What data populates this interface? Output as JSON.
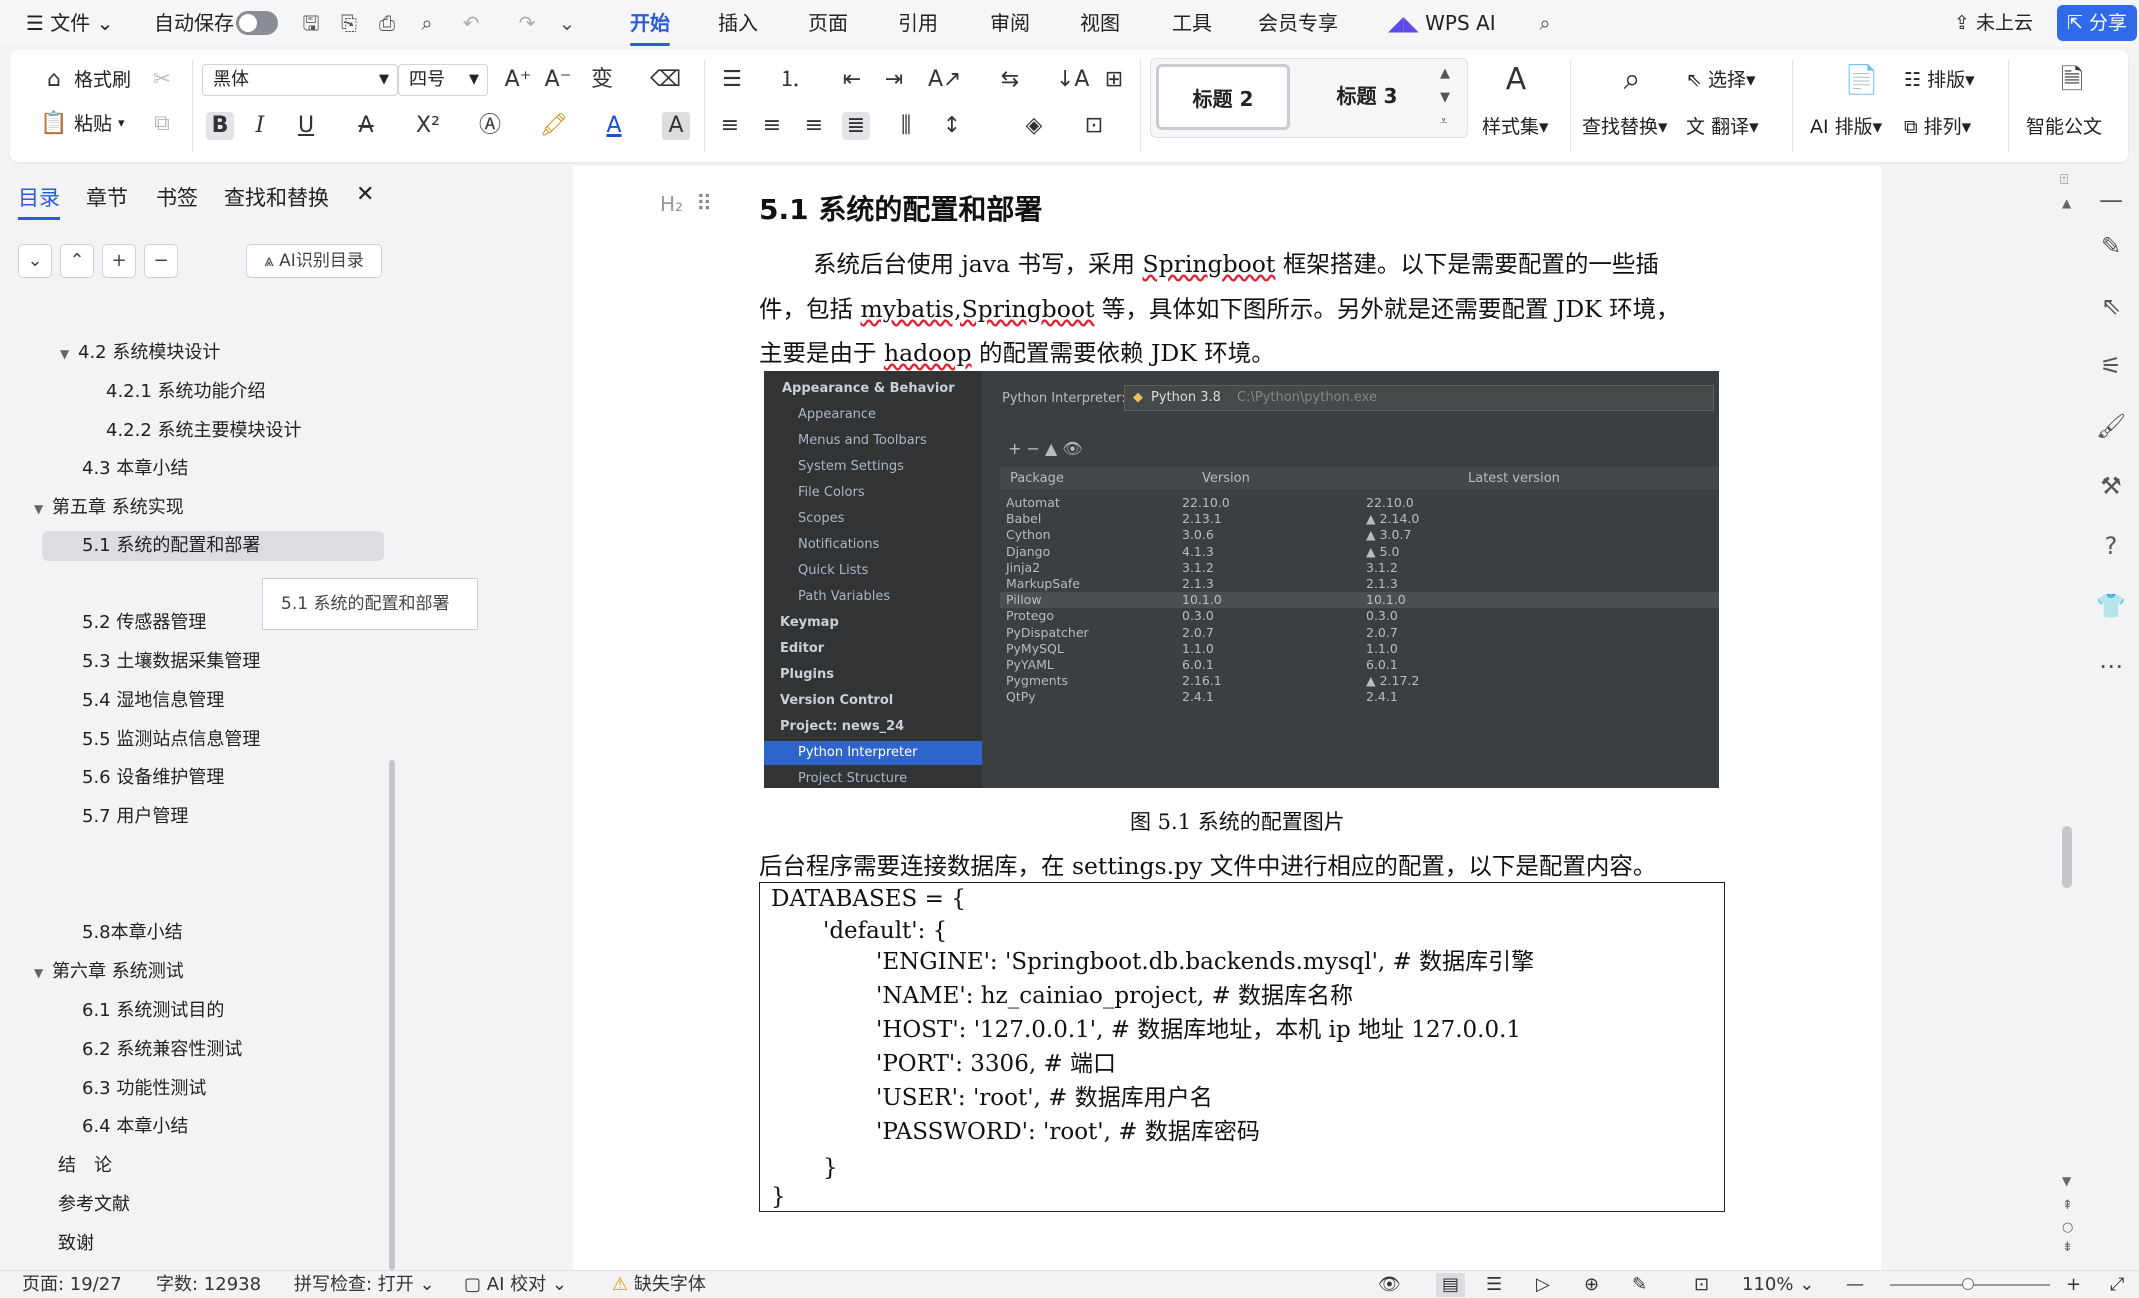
{
  "menubar": {
    "file": "文件",
    "autosave": "自动保存",
    "tabs": [
      "开始",
      "插入",
      "页面",
      "引用",
      "审阅",
      "视图",
      "工具",
      "会员专享"
    ],
    "wps_ai": "WPS AI",
    "cloud": "未上云",
    "share": "分享"
  },
  "ribbon": {
    "format_painter": "格式刷",
    "paste": "粘贴",
    "font_name": "黑体",
    "font_size": "四号",
    "style_h2": "标题 2",
    "style_h3": "标题 3",
    "style_set": "样式集",
    "find_replace": "查找替换",
    "select": "选择",
    "translate": "翻译",
    "ai_layout": "AI 排版",
    "layout": "排版",
    "arrange": "排列",
    "smart_doc": "智能公文"
  },
  "sidebar": {
    "tabs": [
      "目录",
      "章节",
      "书签",
      "查找和替换"
    ],
    "ai_toc": "AI识别目录",
    "tooltip": "5.1 系统的配置和部署",
    "items": [
      {
        "label": "4.2 系统模块设计",
        "expand": "▼"
      },
      {
        "label": "4.2.1 系统功能介绍"
      },
      {
        "label": "4.2.2 系统主要模块设计"
      },
      {
        "label": "4.3 本章小结"
      },
      {
        "label": "第五章 系统实现",
        "expand": "▼"
      },
      {
        "label": "5.1 系统的配置和部署"
      },
      {
        "label": "5.2 传感器管理"
      },
      {
        "label": "5.3 土壤数据采集管理"
      },
      {
        "label": "5.4 湿地信息管理"
      },
      {
        "label": "5.5 监测站点信息管理"
      },
      {
        "label": "5.6 设备维护管理"
      },
      {
        "label": "5.7 用户管理"
      },
      {
        "label": "5.8本章小结"
      },
      {
        "label": "第六章 系统测试",
        "expand": "▼"
      },
      {
        "label": "6.1 系统测试目的"
      },
      {
        "label": "6.2 系统兼容性测试"
      },
      {
        "label": "6.3 功能性测试"
      },
      {
        "label": "6.4 本章小结"
      },
      {
        "label": "结　论"
      },
      {
        "label": "参考文献"
      },
      {
        "label": "致谢"
      }
    ]
  },
  "doc": {
    "heading_marker": "H₂",
    "heading": "5.1  系统的配置和部署",
    "p1_line1_a": "系统后台使用 java 书写，采用 ",
    "p1_line1_u": "Springboot",
    "p1_line1_b": " 框架搭建。以下是需要配置的一些插",
    "p1_line2_a": "件，包括 ",
    "p1_line2_u": "mybatis,Springboot",
    "p1_line2_b": " 等，具体如下图所示。另外就是还需要配置 JDK 环境，",
    "p1_line3_a": "主要是由于 ",
    "p1_line3_u": "hadoop",
    "p1_line3_b": " 的配置需要依赖 JDK 环境。",
    "caption": "图 5.1 系统的配置图片",
    "p2": "后台程序需要连接数据库，在 settings.py 文件中进行相应的配置，以下是配置内容。",
    "code": [
      "DATABASES = {",
      "'default': {",
      "'ENGINE': 'Springboot.db.backends.mysql',       #  数据库引擎",
      "'NAME': hz_cainiao_project, #  数据库名称",
      "'HOST': '127.0.0.1', #  数据库地址，本机  ip  地址  127.0.0.1",
      "'PORT': 3306, #  端口",
      "'USER': 'root',    #  数据库用户名",
      "'PASSWORD': 'root', #  数据库密码",
      "}",
      "}"
    ]
  },
  "screenshot": {
    "side": [
      {
        "label": "Appearance & Behavior",
        "bold": true,
        "indent": 0
      },
      {
        "label": "Appearance",
        "indent": 1
      },
      {
        "label": "Menus and Toolbars",
        "indent": 1
      },
      {
        "label": "System Settings",
        "indent": 1
      },
      {
        "label": "File Colors",
        "indent": 1
      },
      {
        "label": "Scopes",
        "indent": 1
      },
      {
        "label": "Notifications",
        "indent": 1
      },
      {
        "label": "Quick Lists",
        "indent": 1
      },
      {
        "label": "Path Variables",
        "indent": 1
      },
      {
        "label": "Keymap",
        "bold": true,
        "indent": 0
      },
      {
        "label": "Editor",
        "bold": true,
        "indent": 0
      },
      {
        "label": "Plugins",
        "bold": true,
        "indent": 0
      },
      {
        "label": "Version Control",
        "bold": true,
        "indent": 0
      },
      {
        "label": "Project: news_24",
        "bold": true,
        "indent": 0
      },
      {
        "label": "Python Interpreter",
        "indent": 1,
        "selected": true
      },
      {
        "label": "Project Structure",
        "indent": 1
      }
    ],
    "interp_label": "Python Interpreter:",
    "interp_value": "Python 3.8",
    "interp_path": "C:\\Python\\python.exe",
    "headers": [
      "Package",
      "Version",
      "Latest version"
    ],
    "rows": [
      [
        "Automat",
        "22.10.0",
        "22.10.0"
      ],
      [
        "Babel",
        "2.13.1",
        "▲ 2.14.0"
      ],
      [
        "Cython",
        "3.0.6",
        "▲ 3.0.7"
      ],
      [
        "Django",
        "4.1.3",
        "▲ 5.0"
      ],
      [
        "Jinja2",
        "3.1.2",
        "3.1.2"
      ],
      [
        "MarkupSafe",
        "2.1.3",
        "2.1.3"
      ],
      [
        "Pillow",
        "10.1.0",
        "10.1.0"
      ],
      [
        "Protego",
        "0.3.0",
        "0.3.0"
      ],
      [
        "PyDispatcher",
        "2.0.7",
        "2.0.7"
      ],
      [
        "PyMySQL",
        "1.1.0",
        "1.1.0"
      ],
      [
        "PyYAML",
        "6.0.1",
        "6.0.1"
      ],
      [
        "Pygments",
        "2.16.1",
        "▲ 2.17.2"
      ],
      [
        "QtPy",
        "2.4.1",
        "2.4.1"
      ]
    ]
  },
  "status": {
    "page": "页面: 19/27",
    "words": "字数: 12938",
    "spell": "拼写检查: 打开",
    "ai_check": "AI 校对",
    "missing_font": "缺失字体",
    "zoom": "110%"
  }
}
